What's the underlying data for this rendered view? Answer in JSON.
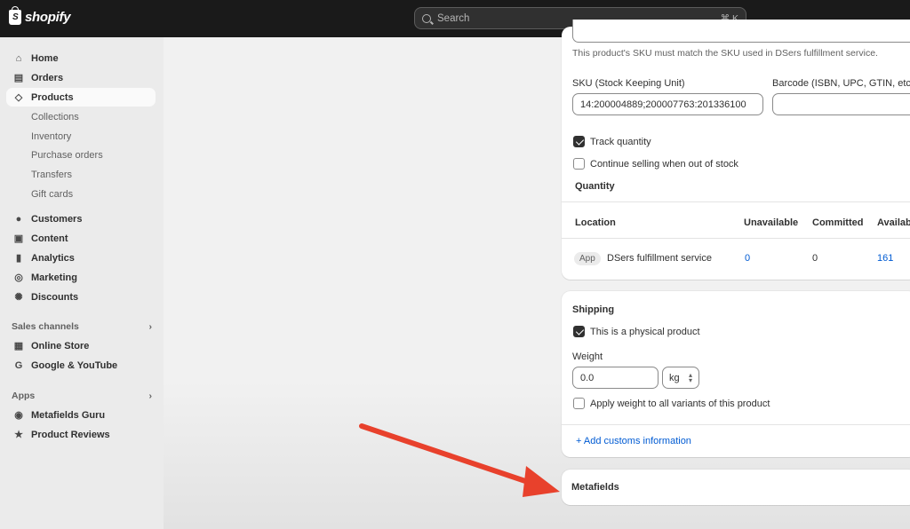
{
  "topbar": {
    "logo_text": "shopify",
    "logo_letter": "S",
    "search_placeholder": "Search",
    "search_shortcut": "⌘ K"
  },
  "sidebar": {
    "items": [
      {
        "label": "Home",
        "icon": "home-icon"
      },
      {
        "label": "Orders",
        "icon": "inbox-icon"
      },
      {
        "label": "Products",
        "icon": "tag-icon",
        "active": true
      },
      {
        "label": "Collections"
      },
      {
        "label": "Inventory"
      },
      {
        "label": "Purchase orders"
      },
      {
        "label": "Transfers"
      },
      {
        "label": "Gift cards"
      },
      {
        "label": "Customers",
        "icon": "person-icon"
      },
      {
        "label": "Content",
        "icon": "content-icon"
      },
      {
        "label": "Analytics",
        "icon": "bar-chart-icon"
      },
      {
        "label": "Marketing",
        "icon": "target-icon"
      },
      {
        "label": "Discounts",
        "icon": "discount-icon"
      }
    ],
    "sales_channels_label": "Sales channels",
    "sales_channels": [
      {
        "label": "Online Store",
        "icon": "store-icon"
      },
      {
        "label": "Google & YouTube",
        "icon": "google-icon"
      }
    ],
    "apps_label": "Apps",
    "apps": [
      {
        "label": "Metafields Guru",
        "icon": "guru-icon"
      },
      {
        "label": "Product Reviews",
        "icon": "star-icon"
      }
    ]
  },
  "inventory_card": {
    "sku_help": "This product's SKU must match the SKU used in DSers fulfillment service.",
    "sku_label": "SKU (Stock Keeping Unit)",
    "sku_value": "14:200004889;200007763:201336100",
    "barcode_label": "Barcode (ISBN, UPC, GTIN, etc.)",
    "barcode_value": "",
    "track_quantity_label": "Track quantity",
    "track_quantity_checked": true,
    "continue_selling_label": "Continue selling when out of stock",
    "continue_selling_checked": false,
    "quantity_heading": "Quantity",
    "table": {
      "headers": [
        "Location",
        "Unavailable",
        "Committed",
        "Availabl"
      ],
      "row": {
        "badge": "App",
        "location": "DSers fulfillment service",
        "unavailable": "0",
        "committed": "0",
        "available": "161"
      }
    }
  },
  "shipping_card": {
    "title": "Shipping",
    "physical_label": "This is a physical product",
    "physical_checked": true,
    "weight_label": "Weight",
    "weight_value": "0.0",
    "weight_unit": "kg",
    "apply_all_label": "Apply weight to all variants of this product",
    "apply_all_checked": false,
    "customs_link": "+ Add customs information"
  },
  "metafields_card": {
    "title": "Metafields"
  },
  "annotation": {
    "arrow_color": "#e8412c"
  }
}
